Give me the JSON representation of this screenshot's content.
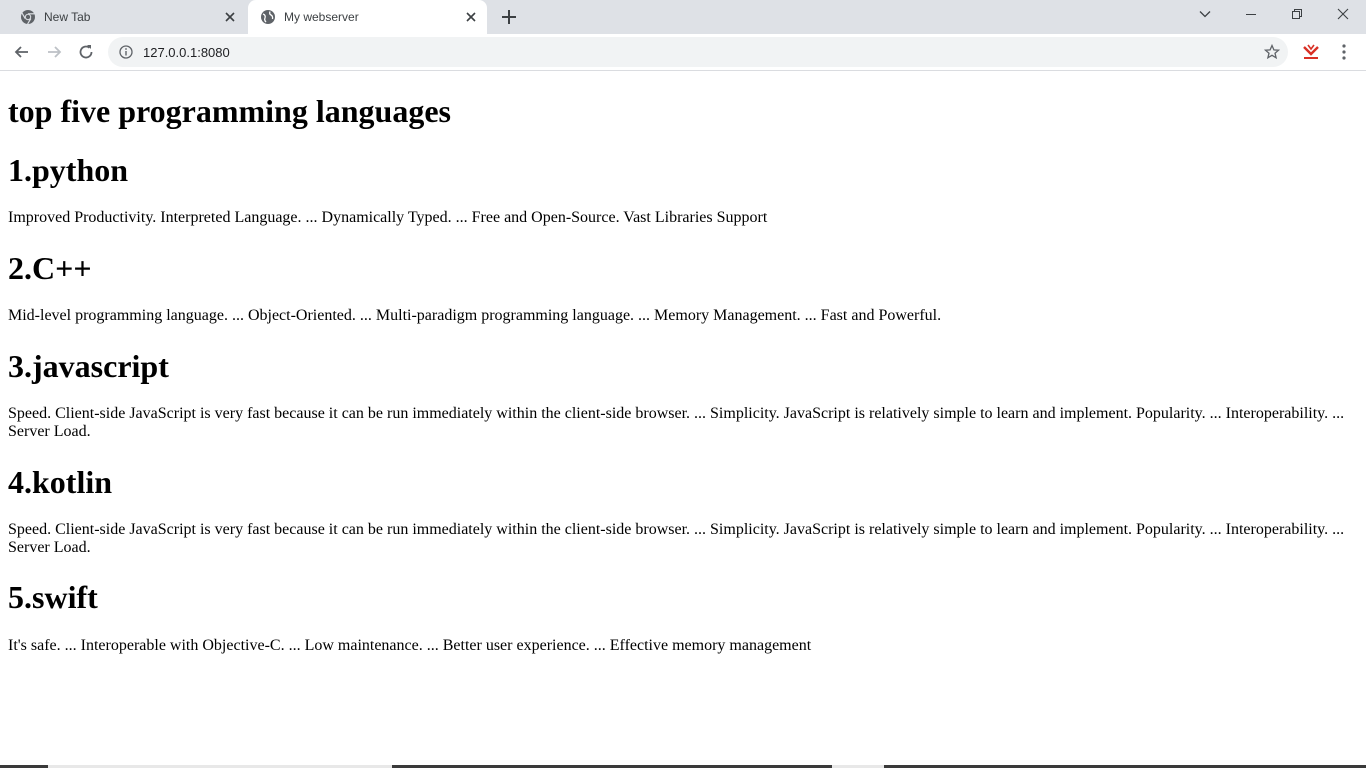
{
  "tabs": [
    {
      "label": "New Tab",
      "icon": "chrome-icon",
      "active": false
    },
    {
      "label": "My webserver",
      "icon": "globe-icon",
      "active": true
    }
  ],
  "toolbar": {
    "url": "127.0.0.1:8080"
  },
  "content": {
    "heading": "top five programming languages",
    "sections": [
      {
        "title": "1.python",
        "text": "Improved Productivity. Interpreted Language. ... Dynamically Typed. ... Free and Open-Source. Vast Libraries Support"
      },
      {
        "title": "2.C++",
        "text": "Mid-level programming language. ... Object-Oriented. ... Multi-paradigm programming language. ... Memory Management. ... Fast and Powerful."
      },
      {
        "title": "3.javascript",
        "text": "Speed. Client-side JavaScript is very fast because it can be run immediately within the client-side browser. ... Simplicity. JavaScript is relatively simple to learn and implement. Popularity. ... Interoperability. ... Server Load."
      },
      {
        "title": "4.kotlin",
        "text": "Speed. Client-side JavaScript is very fast because it can be run immediately within the client-side browser. ... Simplicity. JavaScript is relatively simple to learn and implement. Popularity. ... Interoperability. ... Server Load."
      },
      {
        "title": "5.swift",
        "text": "It's safe. ... Interoperable with Objective-C. ... Low maintenance. ... Better user experience. ... Effective memory management"
      }
    ]
  },
  "colors": {
    "tabstrip": "#dee1e6",
    "omnibox": "#f1f3f4",
    "extension_accent": "#d93025"
  }
}
